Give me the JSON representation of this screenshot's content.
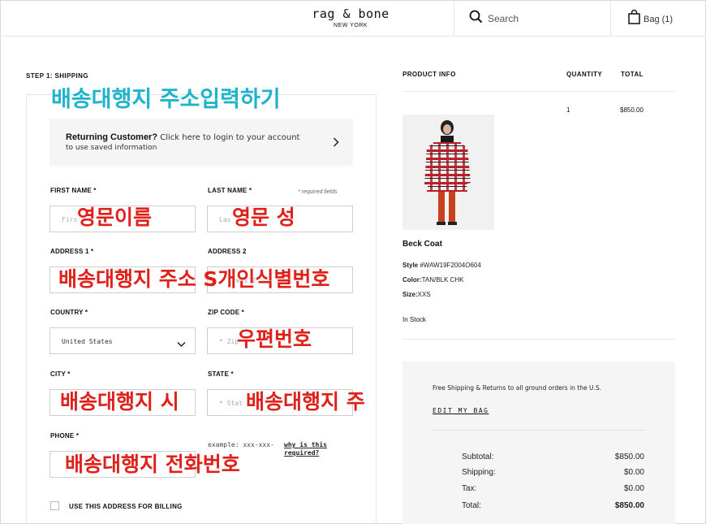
{
  "header": {
    "brand": "rag & bone",
    "brand_sub": "NEW YORK",
    "search_label": "Search",
    "bag_label": "Bag (1)"
  },
  "shipping": {
    "step_title": "STEP 1: SHIPPING",
    "returning_title": "Returning Customer?",
    "returning_text": "Click here to login to your account",
    "returning_text2": "to use saved information",
    "required_note": "* required fields",
    "fields": {
      "first_name": {
        "label": "FIRST NAME *",
        "placeholder": "Firs"
      },
      "last_name": {
        "label": "LAST NAME *",
        "placeholder": "Las"
      },
      "address1": {
        "label": "ADDRESS 1 *",
        "placeholder": ""
      },
      "address2": {
        "label": "ADDRESS 2",
        "placeholder": "ress 2"
      },
      "country": {
        "label": "COUNTRY *",
        "value": "United States"
      },
      "zip": {
        "label": "ZIP CODE *",
        "placeholder": "* Zip"
      },
      "city": {
        "label": "CITY *",
        "placeholder": ""
      },
      "state": {
        "label": "STATE *",
        "placeholder": "* Stat"
      },
      "phone": {
        "label": "PHONE *",
        "placeholder": ""
      }
    },
    "phone_example": "example: xxx-xxx-",
    "why_required": "why is this required?",
    "billing_label": "USE THIS ADDRESS FOR BILLING"
  },
  "annotations": {
    "title": "배송대행지 주소입력하기",
    "first_name": "영문이름",
    "last_name": "영문 성",
    "address": "배송대행지 주소  S개인식별번호",
    "zip": "우편번호",
    "city": "배송대행지 시",
    "state": "배송대행지 주",
    "phone": "배송대행지 전화번호"
  },
  "product": {
    "col_info": "PRODUCT INFO",
    "col_qty": "QUANTITY",
    "col_total": "TOTAL",
    "quantity": "1",
    "total": "$850.00",
    "name": "Beck Coat",
    "style_label": "Style",
    "style_value": "#WAW19F2004O604",
    "color_label": "Color:",
    "color_value": "TAN/BLK CHK",
    "size_label": "Size:",
    "size_value": "XXS",
    "stock": "In Stock"
  },
  "summary": {
    "shipping_note": "Free Shipping & Returns to all ground orders in the U.S.",
    "edit_bag": "EDIT MY BAG",
    "rows": [
      {
        "label": "Subtotal:",
        "value": "$850.00"
      },
      {
        "label": "Shipping:",
        "value": "$0.00"
      },
      {
        "label": "Tax:",
        "value": "$0.00"
      },
      {
        "label": "Total:",
        "value": "$850.00"
      }
    ]
  }
}
